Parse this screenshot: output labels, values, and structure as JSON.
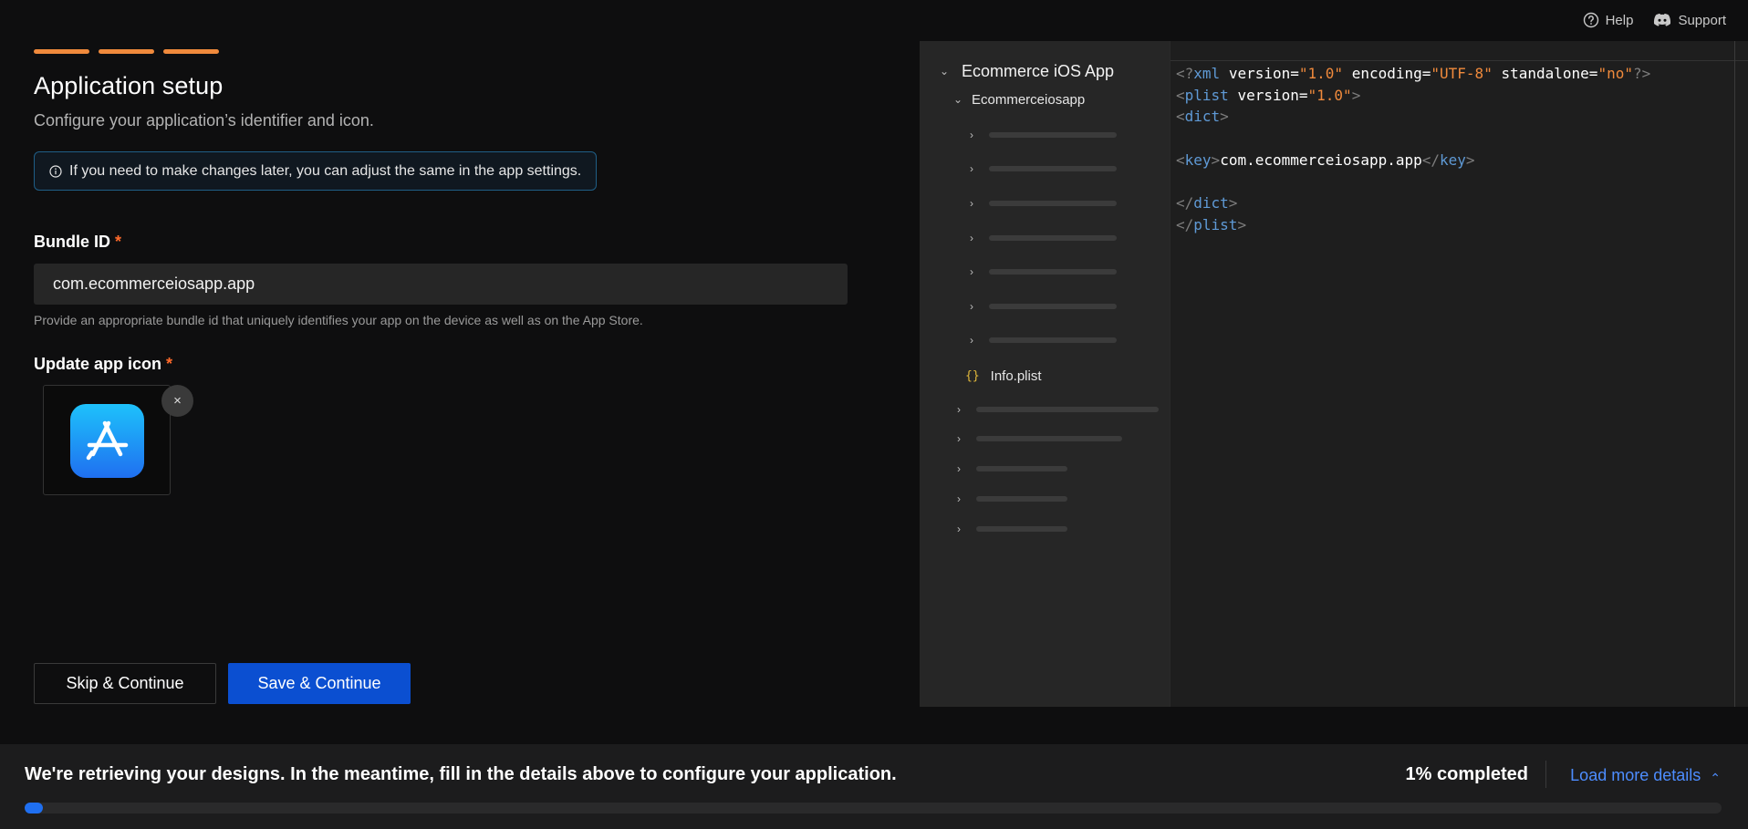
{
  "header": {
    "help_label": "Help",
    "support_label": "Support",
    "help_icon": "question-circle-icon",
    "support_icon": "discord-icon"
  },
  "setup": {
    "steps_total": 3,
    "title": "Application setup",
    "subtitle": "Configure your application’s identifier and icon.",
    "notice": "If you need to make changes later, you can adjust the same in the app settings.",
    "bundle_label": "Bundle ID",
    "required_mark": "*",
    "bundle_value": "com.ecommerceiosapp.app",
    "bundle_help": "Provide an appropriate bundle id that uniquely identifies your app on the device as well as on the App Store.",
    "icon_label": "Update app icon",
    "remove_icon_glyph": "×"
  },
  "actions": {
    "skip_label": "Skip & Continue",
    "save_label": "Save & Continue"
  },
  "tree": {
    "root": "Ecommerce iOS App",
    "folder": "Ecommerceiosapp",
    "file": "Info.plist",
    "file_icon_glyph": "{}"
  },
  "code": {
    "bundle_key": "com.ecommerceiosapp.app"
  },
  "status": {
    "message": "We're retrieving your designs. In the meantime, fill in the details above to configure your application.",
    "percent_label": "1% completed",
    "progress_fraction": 0.01,
    "load_more_label": "Load more details",
    "load_more_glyph": "⌃"
  },
  "colors": {
    "accent": "#f08a3c",
    "primary": "#0b4fd1",
    "link": "#4d8dff",
    "progress": "#1f6ff0"
  }
}
